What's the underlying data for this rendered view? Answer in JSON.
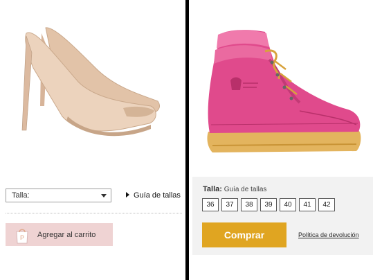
{
  "left_panel": {
    "size_select_value": "Talla:",
    "size_guide_link": "Guía de tallas",
    "add_to_cart_label": "Agregar al carrito"
  },
  "right_panel": {
    "size_label": "Talla:",
    "size_guide_text": "Guía de tallas",
    "sizes": [
      "36",
      "37",
      "38",
      "39",
      "40",
      "41",
      "42"
    ],
    "buy_button_label": "Comprar",
    "return_policy_link": "Política de devolución"
  },
  "colors": {
    "cart_button_bg": "#efd3d3",
    "buy_button_bg": "#e0a521",
    "divider": "#000000",
    "boot_pink": "#e04a8c",
    "heel_nude": "#ecd3bd"
  },
  "icons": {
    "cart_icon": "shopping-bag-icon",
    "link_arrow": "triangle-right-icon",
    "select_arrow": "chevron-down-icon"
  }
}
